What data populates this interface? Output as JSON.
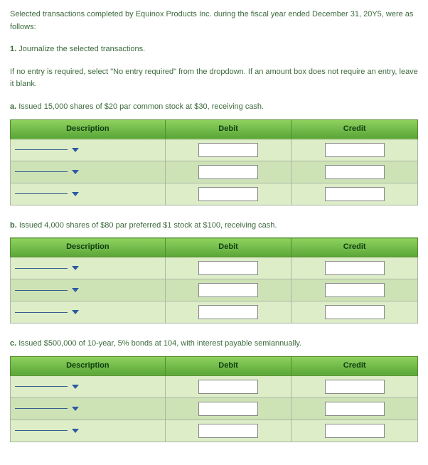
{
  "intro": "Selected transactions completed by Equinox Products Inc. during the fiscal year ended December 31, 20Y5, were as follows:",
  "step_num": "1.",
  "step_text": "Journalize the selected transactions.",
  "note": "If no entry is required, select \"No entry required\" from the dropdown. If an amount box does not require an entry, leave it blank.",
  "headers": {
    "description": "Description",
    "debit": "Debit",
    "credit": "Credit"
  },
  "sections": [
    {
      "letter": "a.",
      "text": "Issued 15,000 shares of $20 par common stock at $30, receiving cash.",
      "rows": 3
    },
    {
      "letter": "b.",
      "text": "Issued 4,000 shares of $80 par preferred $1 stock at $100, receiving cash.",
      "rows": 3
    },
    {
      "letter": "c.",
      "text": "Issued $500,000 of 10-year, 5% bonds at 104, with interest payable semiannually.",
      "rows": 3
    }
  ]
}
